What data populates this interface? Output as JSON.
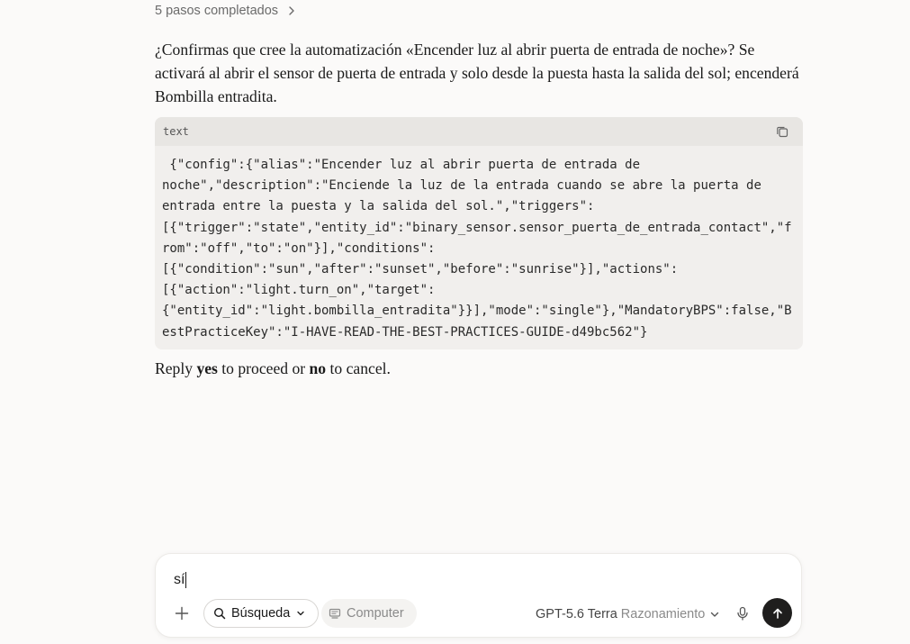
{
  "steps": {
    "label": "5 pasos completados"
  },
  "message": {
    "text": "¿Confirmas que cree la automatización «Encender luz al abrir puerta de entrada de noche»? Se activará al abrir el sensor de puerta de entrada y solo desde la puesta hasta la salida del sol; encenderá Bombilla entradita."
  },
  "code_block": {
    "language": "text",
    "content": " {\"config\":{\"alias\":\"Encender luz al abrir puerta de entrada de\nnoche\",\"description\":\"Enciende la luz de la entrada cuando se abre la puerta de\nentrada entre la puesta y la salida del sol.\",\"triggers\":\n[{\"trigger\":\"state\",\"entity_id\":\"binary_sensor.sensor_puerta_de_entrada_contact\",\"f\nrom\":\"off\",\"to\":\"on\"}],\"conditions\":\n[{\"condition\":\"sun\",\"after\":\"sunset\",\"before\":\"sunrise\"}],\"actions\":\n[{\"action\":\"light.turn_on\",\"target\":\n{\"entity_id\":\"light.bombilla_entradita\"}}],\"mode\":\"single\"},\"MandatoryBPS\":false,\"B\nestPracticeKey\":\"I-HAVE-READ-THE-BEST-PRACTICES-GUIDE-d49bc562\"}"
  },
  "reply": {
    "prefix": "Reply ",
    "yes": "yes",
    "middle": " to proceed or ",
    "no": "no",
    "suffix": " to cancel."
  },
  "composer": {
    "input_value": "sí",
    "search_label": "Búsqueda",
    "computer_label": "Computer",
    "model_name": "GPT-5.6 Terra",
    "model_mode": "Razonamiento"
  },
  "icons": {
    "chevron": "chevron-right-icon",
    "copy": "copy-icon",
    "plus": "plus-icon",
    "search": "search-icon",
    "computer": "computer-icon",
    "dropdown": "chevron-down-icon",
    "mic": "microphone-icon",
    "send": "arrow-up-icon"
  },
  "colors": {
    "background": "#fbfaf9",
    "code_bg": "#f1efed",
    "code_header": "#e8e6e3",
    "send_button": "#1f1e1d"
  }
}
